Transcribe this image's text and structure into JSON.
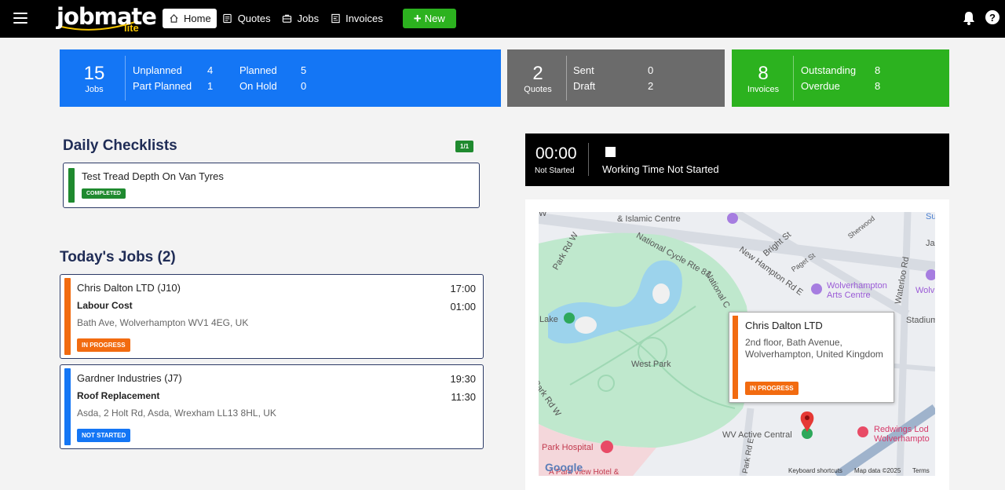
{
  "nav": {
    "brand_main": "jobmate",
    "brand_sub": "lite",
    "items": [
      {
        "label": "Home",
        "icon": "home-icon"
      },
      {
        "label": "Quotes",
        "icon": "quotes-icon"
      },
      {
        "label": "Jobs",
        "icon": "jobs-icon"
      },
      {
        "label": "Invoices",
        "icon": "invoices-icon"
      }
    ],
    "new_label": "New"
  },
  "stats": {
    "jobs": {
      "count": "15",
      "label": "Jobs",
      "rows": [
        {
          "label": "Unplanned",
          "value": "4"
        },
        {
          "label": "Part Planned",
          "value": "1"
        },
        {
          "label": "Planned",
          "value": "5"
        },
        {
          "label": "On Hold",
          "value": "0"
        }
      ]
    },
    "quotes": {
      "count": "2",
      "label": "Quotes",
      "rows": [
        {
          "label": "Sent",
          "value": "0"
        },
        {
          "label": "Draft",
          "value": "2"
        }
      ]
    },
    "invoices": {
      "count": "8",
      "label": "Invoices",
      "rows": [
        {
          "label": "Outstanding",
          "value": "8"
        },
        {
          "label": "Overdue",
          "value": "8"
        }
      ]
    }
  },
  "checklists": {
    "title": "Daily Checklists",
    "progress": "1/1",
    "items": [
      {
        "name": "Test Tread Depth On Van Tyres",
        "status": "COMPLETED"
      }
    ]
  },
  "today": {
    "title": "Today's Jobs (2)",
    "jobs": [
      {
        "customer": "Chris Dalton LTD (J10)",
        "task": "Labour Cost",
        "address": "Bath Ave, Wolverhampton WV1 4EG, UK",
        "time_start": "17:00",
        "time_duration": "01:00",
        "status": "IN PROGRESS",
        "color": "#f26b10"
      },
      {
        "customer": "Gardner Industries (J7)",
        "task": "Roof Replacement",
        "address": "Asda, 2 Holt Rd, Asda, Wrexham LL13 8HL, UK",
        "time_start": "19:30",
        "time_duration": "11:30",
        "status": "NOT STARTED",
        "color": "#1476f5"
      }
    ]
  },
  "timer": {
    "clock": "00:00",
    "status": "Not Started",
    "message": "Working Time Not Started"
  },
  "map": {
    "popup": {
      "title": "Chris Dalton LTD",
      "address": "2nd floor, Bath Avenue, Wolverhampton, United Kingdom",
      "status": "IN PROGRESS"
    },
    "labels": {
      "islamic": "& Islamic Centre",
      "ncr": "National Cycle Rte 81",
      "national": "National C",
      "newhampton": "New Hampton Rd E",
      "bright": "Bright St",
      "paget": "Paget St",
      "sherwood": "Sherwood",
      "waterloo": "Waterloo Rd",
      "wolvarts1": "Wolverhampton",
      "wolvarts2": "Arts Centre",
      "stadium": "Stadium Cl",
      "lake": "Lake",
      "westpark": "West Park",
      "parkrdw1": "Park Rd W",
      "parkrdw2": "Park Rd W",
      "wvactive": "WV Active Central",
      "redwings1": "Redwings Lod",
      "redwings2": "Wolverhampto",
      "parkhospital": "Park Hospital",
      "parkview": "A Park View Hotel &",
      "su": "Su",
      "ja": "Ja",
      "wolv": "Wolv",
      "w": "W",
      "parkrde": "Park Rd E",
      "google": "Google",
      "shortcuts": "Keyboard shortcuts",
      "mapdata": "Map data ©2025",
      "terms": "Terms"
    }
  }
}
